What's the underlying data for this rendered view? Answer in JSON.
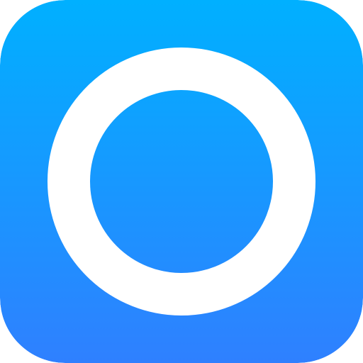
{
  "icon": {
    "name": "ring-icon",
    "gradient_top_color": "#00B0FF",
    "gradient_bottom_color": "#2F80FF",
    "ring_color": "#FFFFFF"
  }
}
